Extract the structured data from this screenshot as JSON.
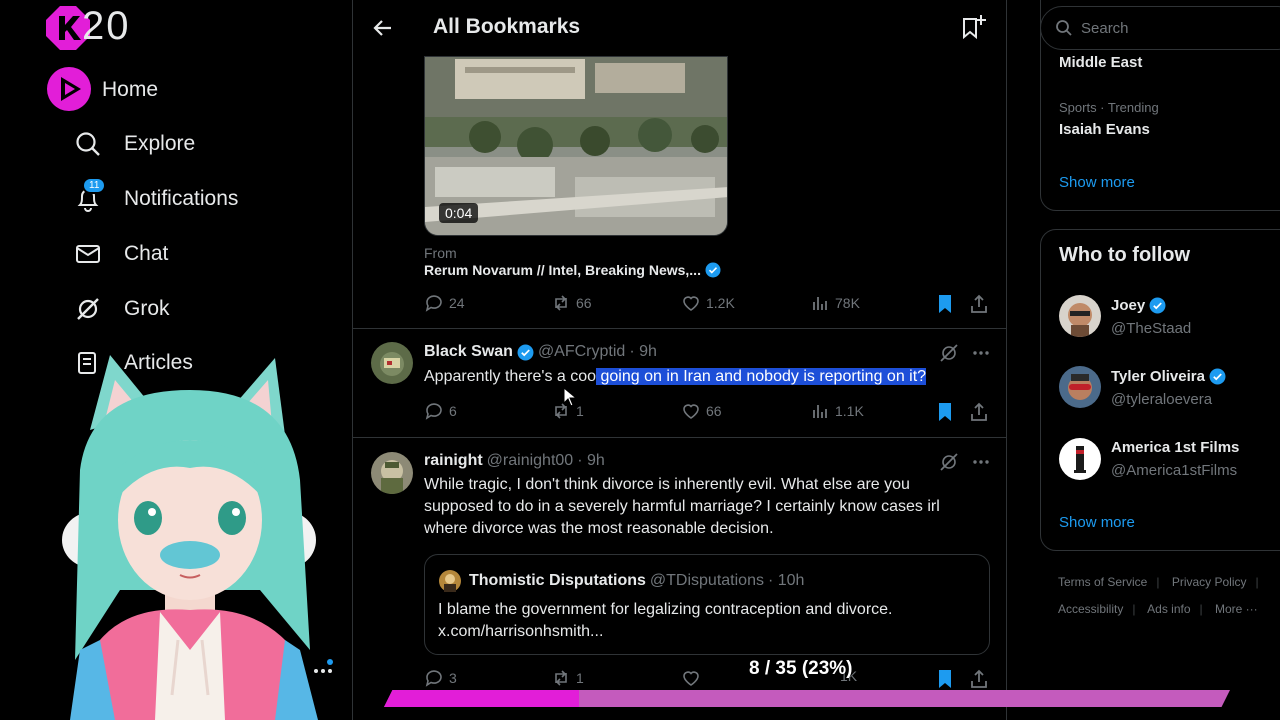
{
  "overlay": {
    "counter": "20",
    "progress_text": "8 / 35 (23%)",
    "progress_fraction": 0.23,
    "colors": {
      "magenta": "#e21ed8",
      "track": "#c45bbd"
    }
  },
  "nav": {
    "items": [
      {
        "label": "Home",
        "icon": "home-icon"
      },
      {
        "label": "Explore",
        "icon": "search-icon"
      },
      {
        "label": "Notifications",
        "icon": "bell-icon",
        "badge": "11"
      },
      {
        "label": "Chat",
        "icon": "mail-icon"
      },
      {
        "label": "Grok",
        "icon": "grok-icon"
      },
      {
        "label": "Articles",
        "icon": "articles-icon"
      }
    ]
  },
  "header": {
    "title": "All Bookmarks"
  },
  "media_post": {
    "duration": "0:04",
    "from_label": "From",
    "from_name": "Rerum Novarum // Intel, Breaking News,...",
    "replies": "24",
    "reposts": "66",
    "likes": "1.2K",
    "views": "78K"
  },
  "tweets": [
    {
      "name": "Black Swan",
      "handle": "@AFCryptid",
      "time": "· 9h",
      "text_plain": "Apparently there's a coo",
      "text_highlight": " going on in Iran and nobody is reporting on it?",
      "replies": "6",
      "reposts": "1",
      "likes": "66",
      "views": "1.1K"
    },
    {
      "name": "rainight",
      "handle": "@rainight00",
      "time": "· 9h",
      "text": "While tragic, I don't think divorce is inherently evil. What else are you supposed to do in a severely harmful marriage? I certainly know cases irl where divorce was the most reasonable decision.",
      "replies": "3",
      "reposts": "1",
      "likes": "",
      "views": "1K"
    }
  ],
  "quote": {
    "name": "Thomistic Disputations",
    "handle": "@TDisputations",
    "time": "· 10h",
    "line1": "I blame the government for legalizing contraception and divorce.",
    "line2": "x.com/harrisonhsmith..."
  },
  "right": {
    "search_placeholder": "Search",
    "trend_top_title": "Middle East",
    "trend2_meta": "Sports · Trending",
    "trend2_title": "Isaiah Evans",
    "show_more": "Show more",
    "wtf_title": "Who to follow",
    "follows": [
      {
        "name": "Joey",
        "handle": "@TheStaad",
        "verified": true
      },
      {
        "name": "Tyler Oliveira",
        "handle": "@tyleraloevera",
        "verified": true
      },
      {
        "name": "America 1st Films",
        "handle": "@America1stFilms",
        "verified": false
      }
    ],
    "footer": {
      "terms": "Terms of Service",
      "privacy": "Privacy Policy",
      "accessibility": "Accessibility",
      "ads": "Ads info",
      "more": "More ···"
    }
  }
}
